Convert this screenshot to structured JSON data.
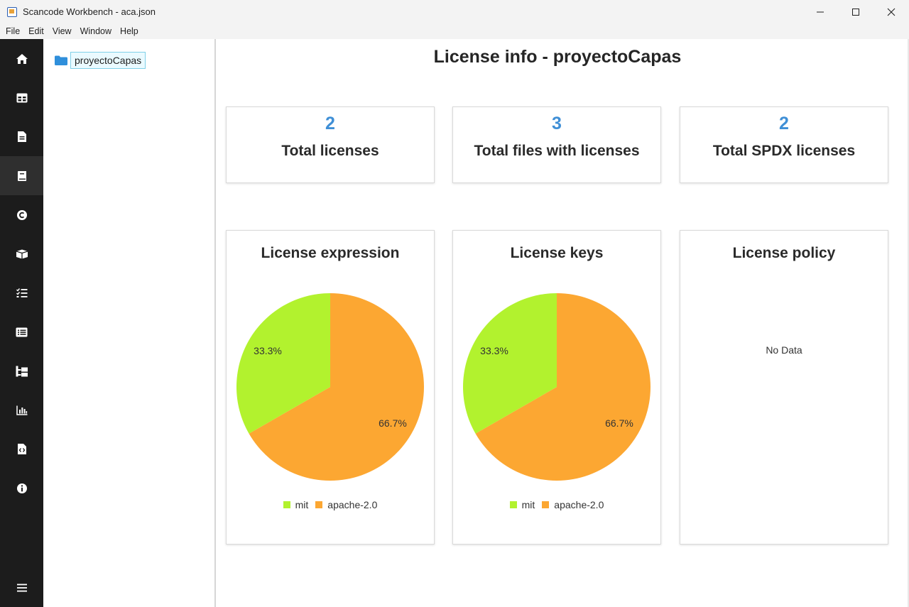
{
  "window": {
    "title": "Scancode Workbench - aca.json"
  },
  "menu": [
    "File",
    "Edit",
    "View",
    "Window",
    "Help"
  ],
  "rail": {
    "items": [
      {
        "icon": "home-icon"
      },
      {
        "icon": "table-view-icon"
      },
      {
        "icon": "file-info-icon"
      },
      {
        "icon": "license-info-icon",
        "active": true
      },
      {
        "icon": "copyright-icon"
      },
      {
        "icon": "package-info-icon"
      },
      {
        "icon": "dependency-checklist-icon"
      },
      {
        "icon": "license-detections-icon"
      },
      {
        "icon": "tree-structure-icon"
      },
      {
        "icon": "chart-summary-icon"
      },
      {
        "icon": "scan-info-icon"
      },
      {
        "icon": "about-icon"
      }
    ],
    "menu_icon": "hamburger-menu-icon"
  },
  "tree": {
    "root_label": "proyectoCapas",
    "root_icon": "folder-icon"
  },
  "main": {
    "title": "License info - proyectoCapas",
    "stats": [
      {
        "value": "2",
        "label": "Total licenses"
      },
      {
        "value": "3",
        "label": "Total files with licenses"
      },
      {
        "value": "2",
        "label": "Total SPDX licenses"
      }
    ],
    "policy_card": {
      "title": "License policy",
      "empty_text": "No Data"
    }
  },
  "colors": {
    "accent": "#3f8fd6",
    "mit": "#b2f22e",
    "apache": "#fca732"
  },
  "chart_data": [
    {
      "type": "pie",
      "title": "License expression",
      "categories": [
        "mit",
        "apache-2.0"
      ],
      "values": [
        33.3,
        66.7
      ],
      "labels": [
        "33.3%",
        "66.7%"
      ],
      "colors": [
        "#b2f22e",
        "#fca732"
      ],
      "legend": "bottom"
    },
    {
      "type": "pie",
      "title": "License keys",
      "categories": [
        "mit",
        "apache-2.0"
      ],
      "values": [
        33.3,
        66.7
      ],
      "labels": [
        "33.3%",
        "66.7%"
      ],
      "colors": [
        "#b2f22e",
        "#fca732"
      ],
      "legend": "bottom"
    }
  ]
}
